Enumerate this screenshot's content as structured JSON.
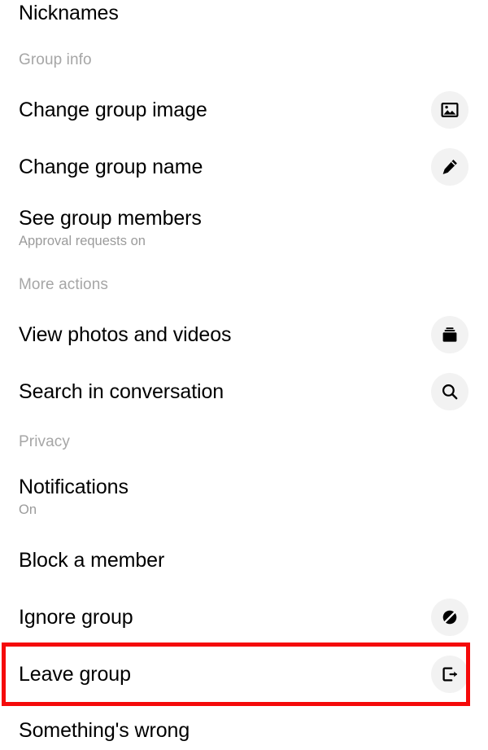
{
  "screen": {
    "name": "group-chat-settings",
    "background_color": "#ffffff",
    "text_primary_color": "#000000",
    "text_secondary_color": "#9b9b9b",
    "section_header_color": "#a6a6a6",
    "icon_circle_color": "#f2f2f2",
    "highlight_color": "#f50a0a"
  },
  "rows": {
    "nicknames": {
      "title": "Nicknames"
    },
    "change_group_image": {
      "title": "Change group image",
      "icon": "image-icon"
    },
    "change_group_name": {
      "title": "Change group name",
      "icon": "pencil-icon"
    },
    "see_group_members": {
      "title": "See group members",
      "subtitle": "Approval requests on"
    },
    "view_photos_and_videos": {
      "title": "View photos and videos",
      "icon": "photo-stack-icon"
    },
    "search_in_conversation": {
      "title": "Search in conversation",
      "icon": "search-icon"
    },
    "notifications": {
      "title": "Notifications",
      "subtitle": "On"
    },
    "block_a_member": {
      "title": "Block a member"
    },
    "ignore_group": {
      "title": "Ignore group",
      "icon": "ignore-slash-icon"
    },
    "leave_group": {
      "title": "Leave group",
      "icon": "logout-arrow-icon"
    },
    "somethings_wrong": {
      "title": "Something's wrong"
    }
  },
  "section_headers": {
    "group_info": "Group info",
    "more_actions": "More actions",
    "privacy": "Privacy"
  }
}
